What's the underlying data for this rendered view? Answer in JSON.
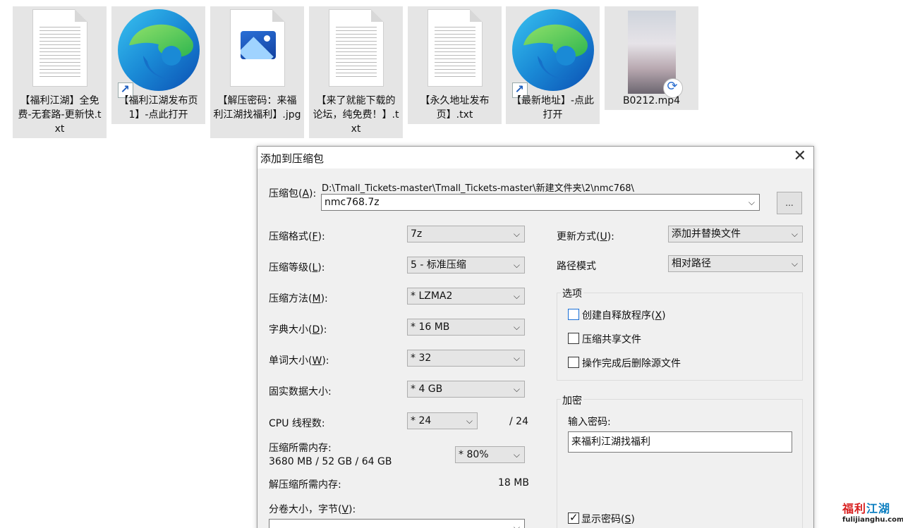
{
  "desktop": {
    "files": [
      {
        "name": "【福利江湖】全免费-无套路-更新快.txt",
        "icon": "text-file-icon"
      },
      {
        "name": "【福利江湖发布页1】-点此打开",
        "icon": "edge-shortcut-icon"
      },
      {
        "name": "【解压密码：来福利江湖找福利】.jpg",
        "icon": "image-file-icon"
      },
      {
        "name": "【来了就能下载的论坛，纯免费！】.txt",
        "icon": "text-file-icon"
      },
      {
        "name": "【永久地址发布页】.txt",
        "icon": "text-file-icon"
      },
      {
        "name": "【最新地址】-点此打开",
        "icon": "edge-shortcut-icon"
      },
      {
        "name": "B0212.mp4",
        "icon": "video-file-icon"
      }
    ]
  },
  "dialog": {
    "title": "添加到压缩包",
    "close_glyph": "✕",
    "archive_label": "压缩包(",
    "archive_key": "A",
    "archive_label_end": "):",
    "archive_path": "D:\\Tmall_Tickets-master\\Tmall_Tickets-master\\新建文件夹\\2\\nmc768\\",
    "archive_name": "nmc768.7z",
    "browse_label": "...",
    "left": {
      "format": {
        "label": "压缩格式(",
        "key": "F",
        "end": "):",
        "value": "7z"
      },
      "level": {
        "label": "压缩等级(",
        "key": "L",
        "end": "):",
        "value": "5 - 标准压缩"
      },
      "method": {
        "label": "压缩方法(",
        "key": "M",
        "end": "):",
        "value": "*  LZMA2"
      },
      "dict": {
        "label": "字典大小(",
        "key": "D",
        "end": "):",
        "value": "*  16 MB"
      },
      "word": {
        "label": "单词大小(",
        "key": "W",
        "end": "):",
        "value": "*  32"
      },
      "solid": {
        "label": "固实数据大小:",
        "value": "*  4 GB"
      },
      "threads": {
        "label": "CPU 线程数:",
        "value": "*  24",
        "max": "/ 24"
      },
      "mem_comp": {
        "label": "压缩所需内存:",
        "detail": "3680 MB / 52 GB / 64 GB",
        "value": "*  80%"
      },
      "mem_decomp": {
        "label": "解压缩所需内存:",
        "value": "18 MB"
      },
      "volume": {
        "label": "分卷大小，字节(",
        "key": "V",
        "end": "):",
        "value": ""
      }
    },
    "right": {
      "update": {
        "label": "更新方式(",
        "key": "U",
        "end": "):",
        "value": "添加并替换文件"
      },
      "path_mode": {
        "label": "路径模式",
        "value": "相对路径"
      },
      "options_title": "选项",
      "opt_sfx": {
        "label": "创建自释放程序(",
        "key": "X",
        "end": ")",
        "checked": false
      },
      "opt_shared": {
        "label": "压缩共享文件",
        "checked": false
      },
      "opt_delete": {
        "label": "操作完成后删除源文件",
        "checked": false
      },
      "encrypt_title": "加密",
      "password_label": "输入密码:",
      "password_value": "来福利江湖找福利",
      "show_pwd": {
        "label": "显示密码(",
        "key": "S",
        "end": ")",
        "checked": true
      }
    }
  },
  "watermark": {
    "text_red": "福利",
    "text_blue": "江湖",
    "url": "fulijianghu.com"
  }
}
